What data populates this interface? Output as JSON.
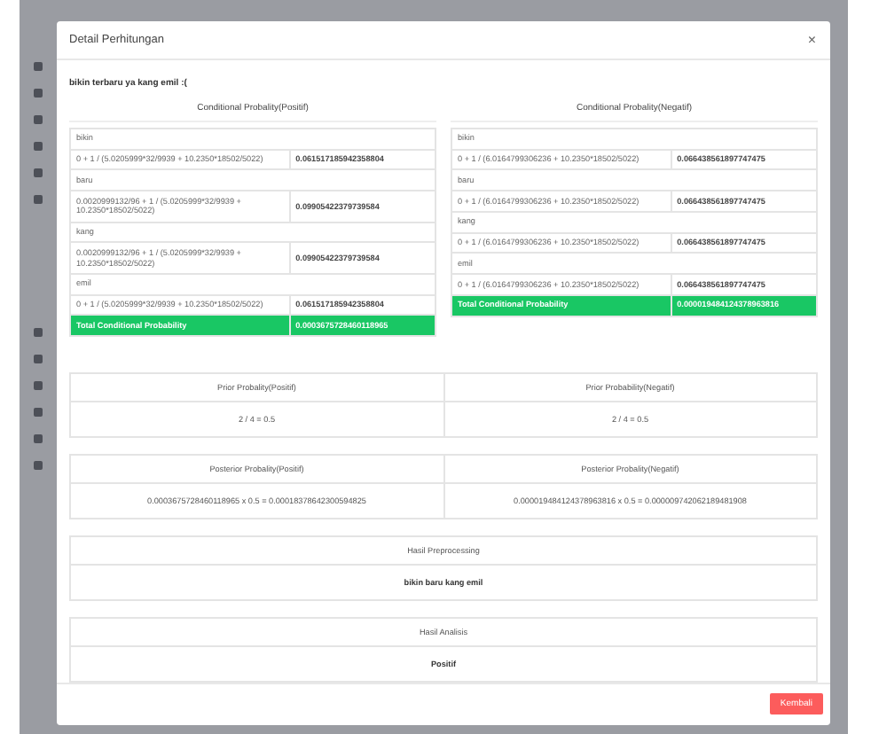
{
  "modal": {
    "title": "Detail Perhitungan",
    "close": "×"
  },
  "intro": "bikin terbaru ya kang emil :(",
  "conditional": [
    {
      "title": "Conditional Probality(Positif)",
      "rows": [
        {
          "word": "bikin",
          "formula": "0 + 1 / (5.0205999*32/9939 + 10.2350*18502/5022)",
          "value": "0.061517185942358804"
        },
        {
          "word": "baru",
          "formula": "0.0020999132/96 + 1 / (5.0205999*32/9939 + 10.2350*18502/5022)",
          "value": "0.09905422379739584"
        },
        {
          "word": "kang",
          "formula": "0.0020999132/96 + 1 / (5.0205999*32/9939 + 10.2350*18502/5022)",
          "value": "0.09905422379739584"
        },
        {
          "word": "emil",
          "formula": "0 + 1 / (5.0205999*32/9939 + 10.2350*18502/5022)",
          "value": "0.061517185942358804"
        }
      ],
      "total": {
        "label": "Total Conditional Probability",
        "value": "0.0003675728460118965"
      }
    },
    {
      "title": "Conditional Probality(Negatif)",
      "rows": [
        {
          "word": "bikin",
          "formula": "0 + 1 / (6.0164799306236 + 10.2350*18502/5022)",
          "value": "0.066438561897747475"
        },
        {
          "word": "baru",
          "formula": "0 + 1 / (6.0164799306236 + 10.2350*18502/5022)",
          "value": "0.066438561897747475"
        },
        {
          "word": "kang",
          "formula": "0 + 1 / (6.0164799306236 + 10.2350*18502/5022)",
          "value": "0.066438561897747475"
        },
        {
          "word": "emil",
          "formula": "0 + 1 / (6.0164799306236 + 10.2350*18502/5022)",
          "value": "0.066438561897747475"
        }
      ],
      "total": {
        "label": "Total Conditional Probability",
        "value": "0.000019484124378963816"
      }
    }
  ],
  "prior": [
    {
      "title": "Prior Probality(Positif)",
      "value": "2 / 4 = 0.5"
    },
    {
      "title": "Prior Probability(Negatif)",
      "value": "2 / 4 = 0.5"
    }
  ],
  "posterior": [
    {
      "title": "Posterior Probality(Positif)",
      "value": "0.0003675728460118965 x 0.5 = 0.00018378642300594825"
    },
    {
      "title": "Posterior Probality(Negatif)",
      "value": "0.000019484124378963816 x 0.5 = 0.000009742062189481908"
    }
  ],
  "preprocessing": {
    "title": "Hasil Preprocessing",
    "value": "bikin baru kang emil"
  },
  "analysis": {
    "title": "Hasil Analisis",
    "value": "Positif"
  },
  "buttons": [
    "Kembali"
  ]
}
